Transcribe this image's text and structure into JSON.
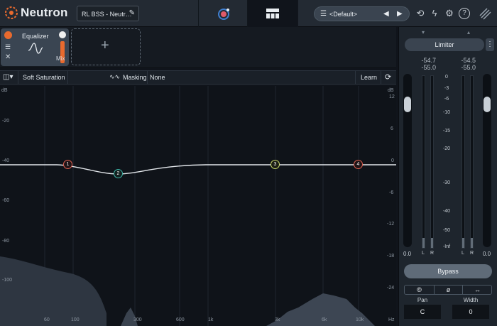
{
  "app": {
    "title": "Neutron"
  },
  "preset": {
    "name": "RL BSS - Neutr…"
  },
  "preset_dropdown": {
    "label": "<Default>"
  },
  "modules": {
    "equalizer": {
      "label": "Equalizer",
      "mix_label": "Mix"
    }
  },
  "toolbar": {
    "saturation_label": "Soft Saturation",
    "masking_label": "Masking",
    "masking_value": "None",
    "learn_label": "Learn"
  },
  "eq": {
    "left_db_unit": "dB",
    "left_scale": [
      "-20",
      "-40",
      "-60",
      "-80",
      "-100"
    ],
    "right_db_unit": "dB",
    "right_scale": [
      "12",
      "6",
      "0",
      "-6",
      "-12",
      "-18",
      "-24"
    ],
    "freq_labels": [
      "60",
      "100",
      "300",
      "600",
      "1k",
      "3k",
      "6k",
      "10k"
    ],
    "hz_label": "Hz",
    "nodes": [
      {
        "label": "1",
        "color": "#e0604f"
      },
      {
        "label": "2",
        "color": "#3fb6a8"
      },
      {
        "label": "3",
        "color": "#c8d66a"
      },
      {
        "label": "4",
        "color": "#e0604f"
      }
    ]
  },
  "meters": {
    "limiter_label": "Limiter",
    "limiter_menu": "⋮",
    "left_peak_1": "-54.7",
    "left_peak_2": "-55.0",
    "right_peak_1": "-54.5",
    "right_peak_2": "-55.0",
    "scale": [
      "0",
      "-3",
      "-6",
      "-10",
      "-15",
      "-20",
      "-30",
      "-40",
      "-50",
      "-Inf"
    ],
    "left_fader_value": "0.0",
    "right_fader_value": "0.0",
    "l_label": "L",
    "r_label": "R",
    "bypass_label": "Bypass",
    "pan_label": "Pan",
    "pan_value": "C",
    "width_label": "Width",
    "width_value": "0"
  },
  "colors": {
    "accent": "#e86a2e",
    "background": "#10141b",
    "panel": "#1e252d"
  }
}
